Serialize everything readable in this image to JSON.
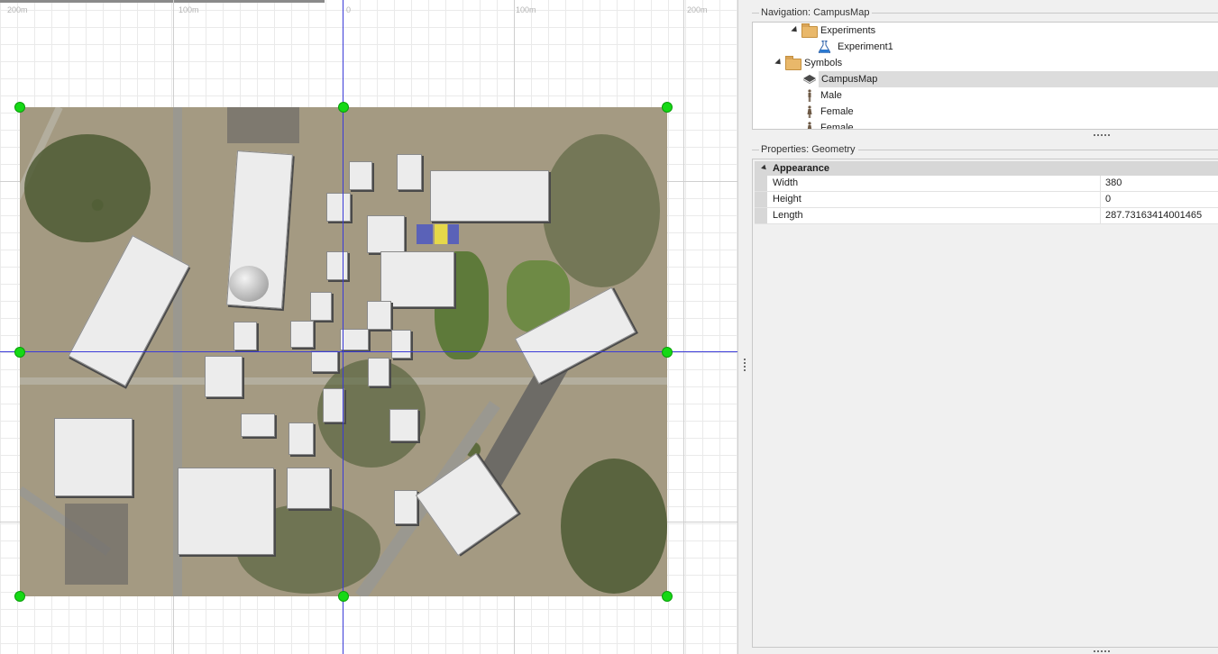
{
  "canvas": {
    "ruler_labels": [
      "200m",
      "100m",
      "0",
      "100m",
      "200m"
    ]
  },
  "navigation": {
    "title": "Navigation: CampusMap",
    "items": [
      {
        "label": "Experiments",
        "icon": "folder-icon"
      },
      {
        "label": "Experiment1",
        "icon": "flask-icon"
      },
      {
        "label": "Symbols",
        "icon": "folder-icon"
      },
      {
        "label": "CampusMap",
        "icon": "map-icon",
        "selected": true
      },
      {
        "label": "Male",
        "icon": "person-icon"
      },
      {
        "label": "Female",
        "icon": "person-icon"
      },
      {
        "label": "Female",
        "icon": "person-icon"
      }
    ]
  },
  "properties": {
    "title": "Properties: Geometry",
    "category": "Appearance",
    "rows": [
      {
        "name": "Width",
        "value": "380"
      },
      {
        "name": "Height",
        "value": "0"
      },
      {
        "name": "Length",
        "value": "287.73163414001465"
      }
    ]
  },
  "colors": {
    "axis": "#3b3bd8",
    "handle": "#15d915",
    "selection": "#dcdcdc"
  }
}
